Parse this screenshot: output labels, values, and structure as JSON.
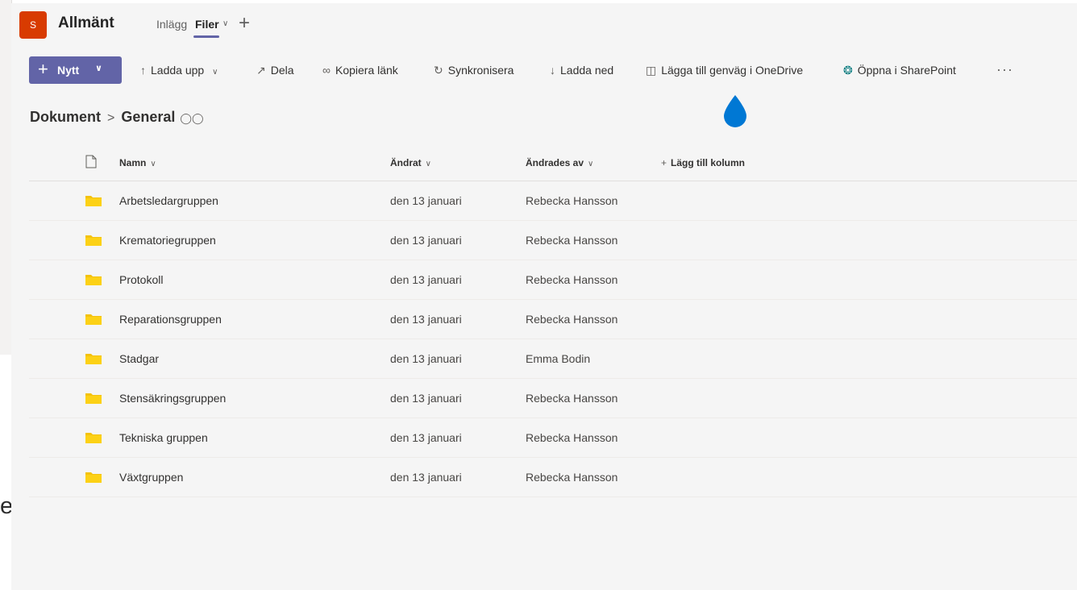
{
  "background": {
    "partial_text": "ess"
  },
  "header": {
    "avatar_letter": "S",
    "channel": "Allmänt",
    "tabs": [
      {
        "label": "Inlägg",
        "active": false
      },
      {
        "label": "Filer",
        "active": true
      }
    ],
    "add_tab": "+"
  },
  "toolbar": {
    "new_label": "Nytt",
    "items": [
      {
        "label": "Ladda upp",
        "icon": "upload-icon",
        "has_menu": true
      },
      {
        "label": "Dela",
        "icon": "share-icon"
      },
      {
        "label": "Kopiera länk",
        "icon": "link-icon"
      },
      {
        "label": "Synkronisera",
        "icon": "sync-icon"
      },
      {
        "label": "Ladda ned",
        "icon": "download-icon"
      },
      {
        "label": "Lägga till genväg i OneDrive",
        "icon": "shortcut-icon"
      },
      {
        "label": "Öppna i SharePoint",
        "icon": "sharepoint-icon"
      }
    ],
    "more": "···"
  },
  "breadcrumb": {
    "root": "Dokument",
    "current": "General"
  },
  "list": {
    "columns": {
      "name": "Namn",
      "modified": "Ändrat",
      "modified_by": "Ändrades av",
      "add_column": "Lägg till kolumn"
    },
    "rows": [
      {
        "name": "Arbetsledargruppen",
        "modified": "den 13 januari",
        "modified_by": "Rebecka Hansson"
      },
      {
        "name": "Krematoriegruppen",
        "modified": "den 13 januari",
        "modified_by": "Rebecka Hansson"
      },
      {
        "name": "Protokoll",
        "modified": "den 13 januari",
        "modified_by": "Rebecka Hansson"
      },
      {
        "name": "Reparationsgruppen",
        "modified": "den 13 januari",
        "modified_by": "Rebecka Hansson"
      },
      {
        "name": "Stadgar",
        "modified": "den 13 januari",
        "modified_by": "Emma Bodin"
      },
      {
        "name": "Stensäkringsgruppen",
        "modified": "den 13 januari",
        "modified_by": "Rebecka Hansson"
      },
      {
        "name": "Tekniska gruppen",
        "modified": "den 13 januari",
        "modified_by": "Rebecka Hansson"
      },
      {
        "name": "Växtgruppen",
        "modified": "den 13 januari",
        "modified_by": "Rebecka Hansson"
      }
    ]
  },
  "colors": {
    "accent": "#6264a7",
    "folder": "#fcd116",
    "drop": "#0078d4",
    "avatar": "#d83b01"
  }
}
